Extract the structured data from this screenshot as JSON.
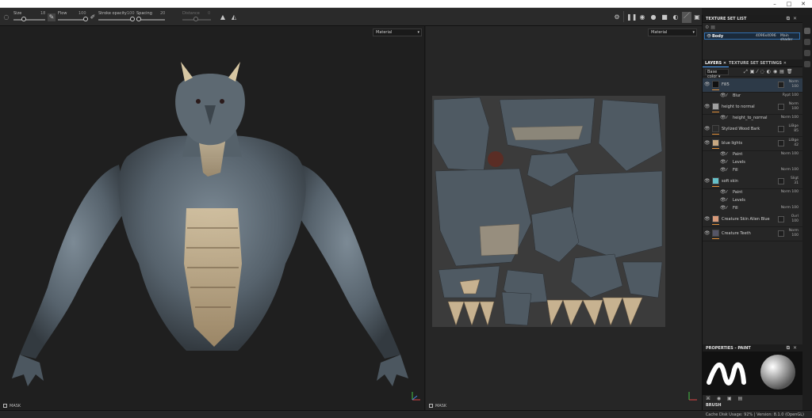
{
  "toolbar": {
    "size_label": "Size",
    "size_value": "18",
    "flow_label": "Flow",
    "flow_value": "100",
    "stroke_opacity_label": "Stroke opacity",
    "stroke_opacity_value": "100",
    "spacing_label": "Spacing",
    "spacing_value": "20",
    "distance_label": "Distance",
    "distance_value": "0"
  },
  "viewport_left": {
    "display_mode": "Material",
    "mask_label": "MASK"
  },
  "viewport_right": {
    "display_mode": "Material",
    "mask_label": "MASK"
  },
  "texture_set_list": {
    "title": "TEXTURE SET LIST",
    "row": {
      "name": "Body",
      "resolution": "4096x4096",
      "shader": "Main shader"
    }
  },
  "layers_panel": {
    "tabs": [
      "LAYERS",
      "TEXTURE SET SETTINGS"
    ],
    "channel": "Base color",
    "layers": [
      {
        "name": "Fill5",
        "blend": "Norm",
        "opacity": "100"
      },
      {
        "name": "Blur",
        "blend": "Rypt",
        "opacity": "100",
        "sub": true
      },
      {
        "name": "height to normal",
        "blend": "Norm",
        "opacity": "100"
      },
      {
        "name": "height_to_normal",
        "blend": "Norm",
        "opacity": "100",
        "sub": true
      },
      {
        "name": "Stylized Wood Bark",
        "blend": "LiBge",
        "opacity": "85"
      },
      {
        "name": "blue lights",
        "blend": "LiBge",
        "opacity": "42"
      },
      {
        "name": "Paint",
        "blend": "Norm",
        "opacity": "100",
        "sub": true
      },
      {
        "name": "Levels",
        "sub": true
      },
      {
        "name": "Fill",
        "blend": "Norm",
        "opacity": "100",
        "sub": true
      },
      {
        "name": "soft skin",
        "blend": "Sligt",
        "opacity": "31"
      },
      {
        "name": "Paint",
        "blend": "Norm",
        "opacity": "100",
        "sub": true
      },
      {
        "name": "Levels",
        "sub": true
      },
      {
        "name": "Fill",
        "blend": "Norm",
        "opacity": "100",
        "sub": true
      },
      {
        "name": "Creature Skin Alien Blue",
        "blend": "Ovrl",
        "opacity": "100"
      },
      {
        "name": "Creature Teeth",
        "blend": "Norm",
        "opacity": "100"
      }
    ]
  },
  "properties": {
    "title": "PROPERTIES - PAINT",
    "footer": "BRUSH"
  },
  "status_bar": {
    "text": "Cache Disk Usage: 92% | Version: 8.1.0 (OpenGL)"
  },
  "colors": {
    "accent": "#4aa3ff",
    "orange_bar": "#e3913a",
    "panel_bg": "#262626"
  }
}
